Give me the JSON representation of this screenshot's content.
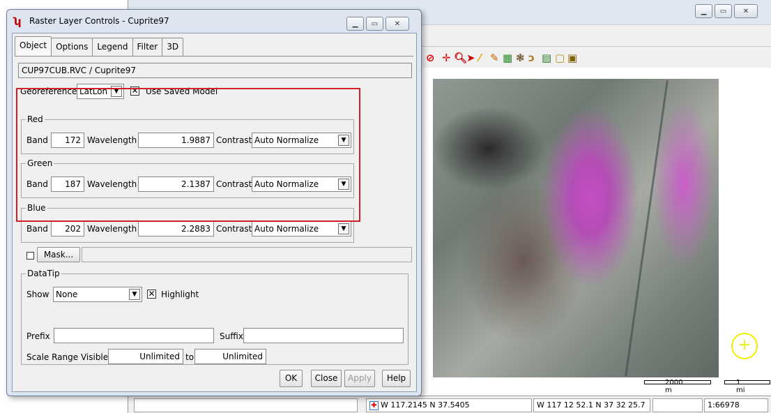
{
  "map_window": {
    "toolbar_icons": [
      "no-entry-icon",
      "pan-icon",
      "zoom-icon",
      "pointer-icon",
      "measure-icon",
      "edit-icon",
      "layers-icon",
      "select-icon",
      "lasso-icon",
      "chart-icon",
      "box-icon",
      "table-icon"
    ],
    "scale_label_metric": "2000 m",
    "scale_label_imperial": "1 mi",
    "status": {
      "coords_decimal": "W 117.2145  N 37.5405",
      "coords_dms": "W 117 12 52.1  N 37 32 25.7",
      "scale": "1:66978"
    }
  },
  "dialog": {
    "title": "Raster Layer Controls - Cuprite97",
    "tabs": [
      {
        "label": "Object"
      },
      {
        "label": "Options"
      },
      {
        "label": "Legend"
      },
      {
        "label": "Filter"
      },
      {
        "label": "3D"
      }
    ],
    "object_path": "CUP97CUB.RVC / Cuprite97",
    "georeference_label": "Georeference",
    "georeference_value": "LatLon",
    "use_saved_model_label": "Use Saved Model",
    "use_saved_model_checked": true,
    "channels": [
      {
        "name": "Red",
        "band_label": "Band",
        "band": "172",
        "wavelength_label": "Wavelength",
        "wavelength": "1.9887",
        "contrast_label": "Contrast",
        "contrast": "Auto Normalize"
      },
      {
        "name": "Green",
        "band_label": "Band",
        "band": "187",
        "wavelength_label": "Wavelength",
        "wavelength": "2.1387",
        "contrast_label": "Contrast",
        "contrast": "Auto Normalize"
      },
      {
        "name": "Blue",
        "band_label": "Band",
        "band": "202",
        "wavelength_label": "Wavelength",
        "wavelength": "2.2883",
        "contrast_label": "Contrast",
        "contrast": "Auto Normalize"
      }
    ],
    "mask_label": "Mask...",
    "datatip": {
      "title": "DataTip",
      "show_label": "Show",
      "show_value": "None",
      "highlight_label": "Highlight",
      "highlight_checked": true,
      "prefix_label": "Prefix",
      "prefix_value": "",
      "suffix_label": "Suffix",
      "suffix_value": "",
      "scale_range_label": "Scale Range Visible",
      "scale_min": "Unlimited",
      "to_label": "to",
      "scale_max": "Unlimited"
    },
    "buttons": {
      "ok": "OK",
      "close": "Close",
      "apply": "Apply",
      "help": "Help"
    }
  }
}
